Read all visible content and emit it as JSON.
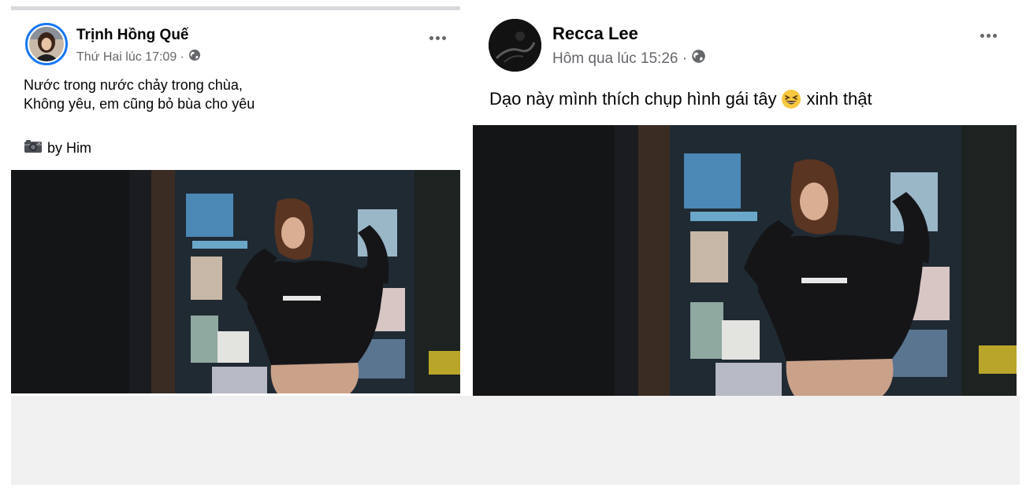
{
  "posts": [
    {
      "author": "Trịnh Hồng Quế",
      "timestamp": "Thứ Hai lúc 17:09 ·",
      "privacy_icon": "globe-icon",
      "more_icon": "more-options-icon",
      "caption_lines": [
        "Nước trong nước chảy trong chùa,",
        "Không yêu, em cũng bỏ bùa cho yêu"
      ],
      "credit_icon": "camera-icon",
      "credit_text": "by Him",
      "photo_alt": "post-photo"
    },
    {
      "author": "Recca Lee",
      "timestamp": "Hôm qua lúc 15:26 ·",
      "privacy_icon": "globe-icon",
      "more_icon": "more-options-icon",
      "caption_before": "Dạo này mình thích chụp hình gái tây",
      "caption_emoji": "grinning-squinting-face-icon",
      "caption_after": "xinh thật",
      "photo_alt": "post-photo"
    }
  ],
  "colors": {
    "secondary_text": "#65676b",
    "primary_text": "#050505",
    "avatar_ring": "#1877f2",
    "feed_background": "#f0f0f0"
  }
}
